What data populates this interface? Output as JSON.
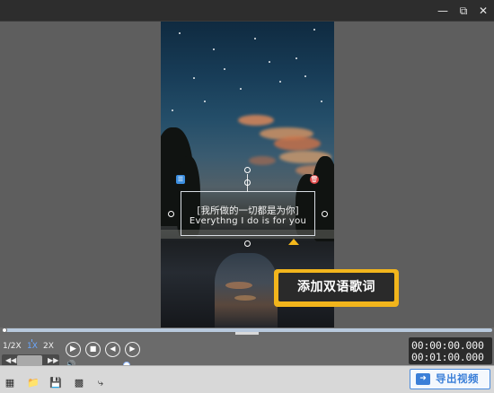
{
  "window": {
    "minimize_icon": "minimize-icon",
    "maximize_icon": "restore-icon",
    "close_icon": "close-icon"
  },
  "preview": {
    "subtitle_cn": "[我所做的一切都是为你]",
    "subtitle_en": "Everythng I do is for you",
    "list_icon": "list-icon",
    "delete_icon": "trash-icon"
  },
  "callout": {
    "label": "添加双语歌词",
    "color": "#f2b51c"
  },
  "playback": {
    "speeds": [
      "1/2X",
      "1X",
      "2X"
    ],
    "active_speed": "1X",
    "current_time": "00:00:00.000",
    "total_time": "00:01:00.000",
    "progress": 0.0,
    "volume": 0.85
  },
  "toolbar": {
    "icons": [
      "new-project-icon",
      "open-folder-icon",
      "save-icon",
      "save-as-icon",
      "share-icon"
    ]
  },
  "export": {
    "label": "导出视频",
    "accent": "#3b7fd8"
  }
}
